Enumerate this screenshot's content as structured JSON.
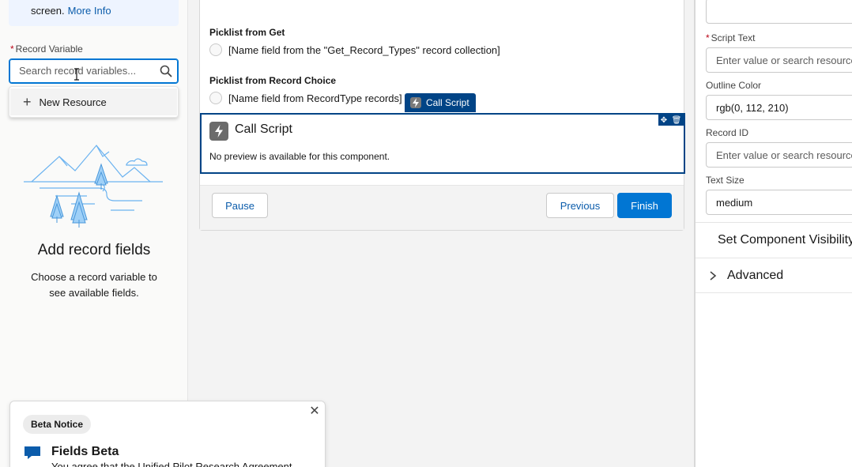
{
  "left": {
    "info_text": "screen.",
    "info_link": "More Info",
    "record_variable_label": "Record Variable",
    "search_placeholder": "Search record variables...",
    "new_resource": "New Resource",
    "empty_title": "Add record fields",
    "empty_desc": "Choose a record variable to see available fields."
  },
  "beta_notice": {
    "badge": "Beta Notice",
    "title": "Fields Beta",
    "body": "You agree that the Unified Pilot Research Agreement"
  },
  "canvas": {
    "picklist_get_label": "Picklist from Get",
    "picklist_get_option": "[Name field from the \"Get_Record_Types\" record collection]",
    "picklist_choice_label": "Picklist from Record Choice",
    "picklist_choice_option": "[Name field from RecordType records]",
    "tag_label": "Call Script",
    "component_title": "Call Script",
    "component_preview": "No preview is available for this component.",
    "buttons": {
      "pause": "Pause",
      "previous": "Previous",
      "finish": "Finish"
    }
  },
  "right": {
    "script_text_label": "Script Text",
    "script_text_placeholder": "Enter value or search resources...",
    "outline_color_label": "Outline Color",
    "outline_color_value": "rgb(0, 112, 210)",
    "record_id_label": "Record ID",
    "record_id_placeholder": "Enter value or search resources...",
    "text_size_label": "Text Size",
    "text_size_value": "medium",
    "sections": [
      "Set Component Visibility",
      "Advanced"
    ]
  },
  "colors": {
    "brand": "#0176d3",
    "selected": "#014486",
    "link": "#0b5cab",
    "required": "#ba0517"
  }
}
